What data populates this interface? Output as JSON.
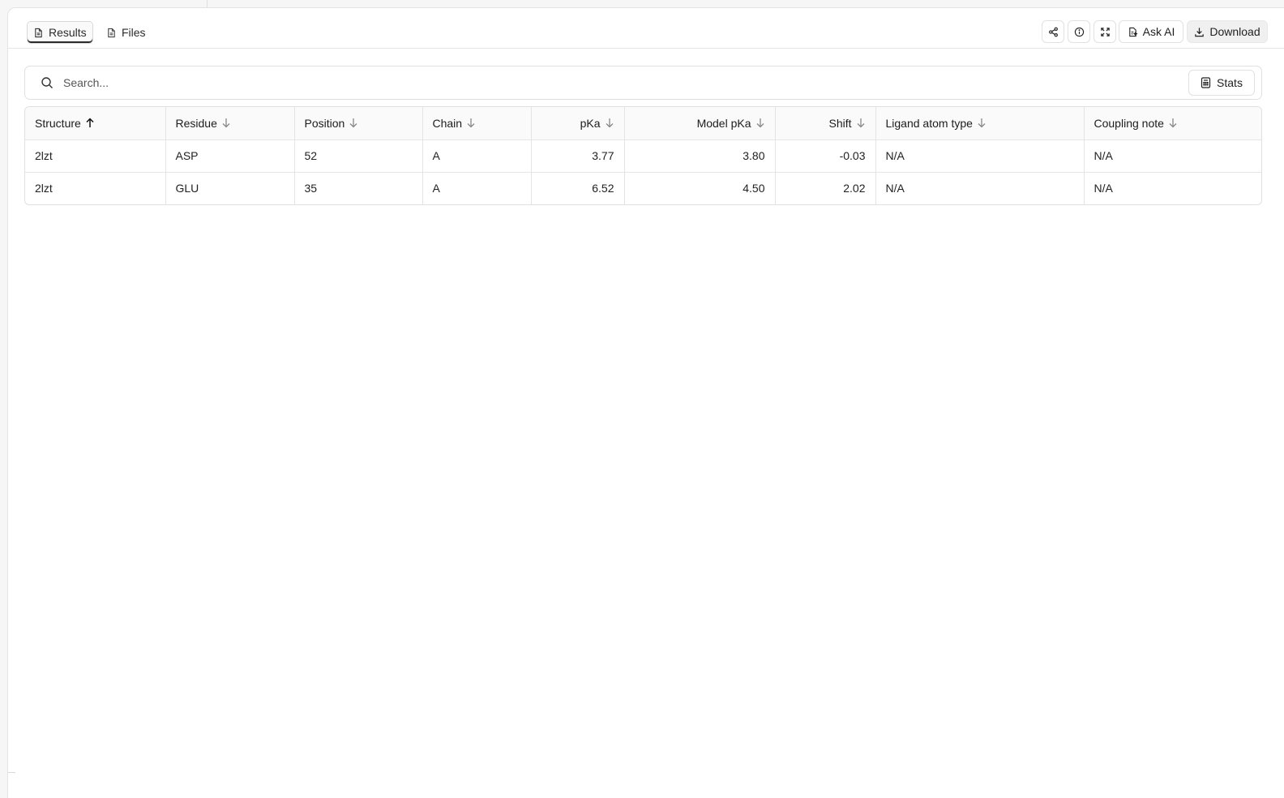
{
  "tabs": [
    {
      "label": "Results",
      "icon": "document-icon",
      "active": true
    },
    {
      "label": "Files",
      "icon": "document-icon",
      "active": false
    }
  ],
  "toolbar": {
    "share_icon": "share-icon",
    "info_icon": "info-icon",
    "expand_icon": "expand-icon",
    "ask_ai_label": "Ask AI",
    "download_label": "Download"
  },
  "search": {
    "placeholder": "Search...",
    "stats_label": "Stats"
  },
  "table": {
    "columns": [
      {
        "label": "Structure",
        "sort": "asc"
      },
      {
        "label": "Residue",
        "sort": "none"
      },
      {
        "label": "Position",
        "sort": "none"
      },
      {
        "label": "Chain",
        "sort": "none"
      },
      {
        "label": "pKa",
        "sort": "none"
      },
      {
        "label": "Model pKa",
        "sort": "none"
      },
      {
        "label": "Shift",
        "sort": "none"
      },
      {
        "label": "Ligand atom type",
        "sort": "none"
      },
      {
        "label": "Coupling note",
        "sort": "none"
      }
    ],
    "rows": [
      [
        "2lzt",
        "ASP",
        "52",
        "A",
        "3.77",
        "3.80",
        "-0.03",
        "N/A",
        "N/A"
      ],
      [
        "2lzt",
        "GLU",
        "35",
        "A",
        "6.52",
        "4.50",
        "2.02",
        "N/A",
        "N/A"
      ]
    ]
  }
}
